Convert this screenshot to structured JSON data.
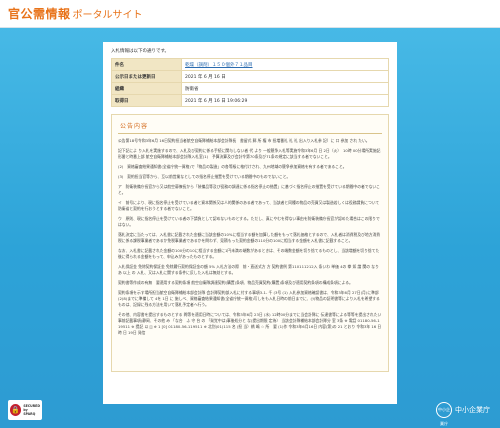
{
  "header": {
    "logo_main": "官公需情報",
    "logo_sub": "ポータルサイト"
  },
  "intro_text": "入札情報は以下の通りです。",
  "meta_rows": [
    {
      "label": "件名",
      "value": "乾燥（調剤）１５０個外７１品目",
      "is_link": true
    },
    {
      "label": "公示日または更新日",
      "value": "2021 年 6 月 16 日",
      "is_link": false
    },
    {
      "label": "組織",
      "value": "防衛省",
      "is_link": false
    },
    {
      "label": "取得日",
      "value": "2021 年 6 月 16 日 19:06:29",
      "is_link": false
    }
  ],
  "content": {
    "title": "公告内容",
    "paragraphs": [
      "公告第18号令和3年6月 16日契約担当者航空自衛隊補給本部会計隊長　書留式 郵 所 権 市 担増番礼 礼 礼 出入り入札参 記）に 口 参加 され たい。",
      "記下記によ り入札を実施するので、入札及び契約に係る手続に関与しない者 代 より 一般競争入札等実施令和3年6月 日 2日（火）　10時 00分場所実施記形番と時番上部 航空自衛隊補給本部会計隊入札室(1)　予算決算及び会計令第70条及び71条の規定に該当する者でないこと。",
      "(2)　資格審査結果通知書(全省庁統一資格)で「物品の製造」の各等級に格付けされ、九州地域の競争参加資格を有する者であること。",
      "(3)　契約担当官等から、互以前営業なとしての指名停止措置を受けている期間中のものでないこと。",
      "ア　防衛装備庁長官から又は航空幕僚長から「装備品等及び役務の調達に係る指名停止の措置」に基づく指名停止の措置を受けている期間中の者でないこと。",
      "イ　前号により、現に指名停止を受けている者と資本関係又は人的関係のある者であって、当該者と同種の物品の売買又は製造若しくは役務請負について防衛省と契約を行おうとする者でないこと。",
      "ウ　原則、現に指名停止を受けている者の下請負として認めないものとする。ただし、真にやむを得ない事由を防衛装備庁長官が認めた場合はこの限りではない。",
      "落札決定に当たっては、入札書に記載された金額に当該金額の10%に相当する額を加算した額をもって落札価格とするので、入札者は消費税及び地方消費税に係る課税事業者であるか免税事業者であるかを問わず、見積もった契約金額の110分の100に相当する金額を入札書に記載すること。",
      "なお、入札書に記載された金額の100分の10に相当する金額に1円未満の端数があるときは、その端数金額を切り捨てるものとし、当該増額を切り捨てた後に得られる金額をもって、申込みがあったものとする。",
      "入札保証金 免除契約保証金 免除履行契約保証金の額 5% 入札方法の際　前・直送式方 方 契約書例 第110111212入 条いわ 単価 4の 拳 如 論 関の なり あ 以上 の 入札、又は入札に関する条件に反した入札は無効とする。",
      "契約書等作成の有無　要適用する契約条項 航空自衛隊調達契約(購置)条項、物品売買契約(購置)条項及び適用契約条項の構成条項による。",
      "契約条項を示す場所担当航空自衛隊補給本部会計隊 会計隊契約部入札に付する事項3-1- 千 (3号 (1) 入札参加資格確認書は、令和3年6月 27日(月)に準部(2)8)までに準備して 4を 1日 に 施しべ、資格審査結果通知書(全省庁統一資格)写しをも入札日時の前日までに、(ﾗ)物品の証明書等により入札を希望するものは、記録に残る方法を用いて落札予定者へ行う。",
      "その他、内容書を提出するものとする 問等を適用日時については、令和3年6月 23日 (水) 12時00分までに当会計隊に 伝達書等による等等を提出されたい 事前記載事項(静岡、その他 み 「な台　ふ 守 台 の 「発覚中は)事後処分と な(提出期限 定為） 当該会計隊補給本部会計隊分 室 3条 ※ 電話 01180-56-119511 ※ 提記 以 [] ※ 1 [0] 01180-56-119511 ※ 北別(01)115 名 (担 当）橋 嶋 ☆ 所　要 (1)作 令和3年6月16日 内容(第)の 21 とおり 令和3年 16 日 時 日 19日 発信"
    ]
  },
  "footer": {
    "secured_line1": "SECURED",
    "secured_line2": "by SPARQ",
    "brand_circle": "中小企業庁",
    "brand_text": "中小企業庁"
  },
  "colors": {
    "accent": "#e8731a",
    "background_blue": "#2da3d8",
    "table_header": "#f1e6c4"
  }
}
